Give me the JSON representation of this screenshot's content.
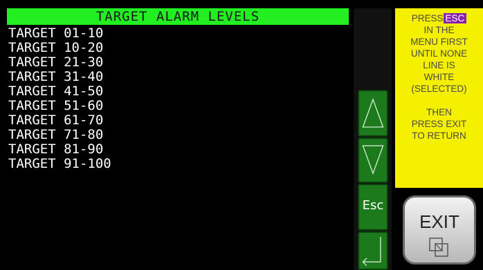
{
  "panel": {
    "title": "TARGET ALARM LEVELS",
    "items": [
      {
        "label": "TARGET 01-10"
      },
      {
        "label": "TARGET 10-20"
      },
      {
        "label": "TARGET 21-30"
      },
      {
        "label": "TARGET 31-40"
      },
      {
        "label": "TARGET 41-50"
      },
      {
        "label": "TARGET 51-60"
      },
      {
        "label": "TARGET 61-70"
      },
      {
        "label": "TARGET 71-80"
      },
      {
        "label": "TARGET 81-90"
      },
      {
        "label": "TARGET 91-100"
      }
    ]
  },
  "nav": {
    "up_icon": "triangle-up-icon",
    "down_icon": "triangle-down-icon",
    "esc_label": "Esc",
    "enter_icon": "enter-arrow-icon"
  },
  "help": {
    "line1_text": "PRESS",
    "esc_badge": "ESC",
    "line2": "IN THE",
    "line3": "MENU FIRST",
    "line4": "UNTIL NONE",
    "line5": "LINE IS",
    "line6": "WHITE",
    "line7": "(SELECTED)",
    "line8": "THEN",
    "line9": "PRESS EXIT",
    "line10": "TO RETURN"
  },
  "exit": {
    "label": "EXIT",
    "icon": "exit-window-icon"
  },
  "colors": {
    "title_bg": "#22ee22",
    "nav_button": "#1c7a1c",
    "help_bg": "#f4f000",
    "esc_badge_bg": "#8a20b4"
  }
}
